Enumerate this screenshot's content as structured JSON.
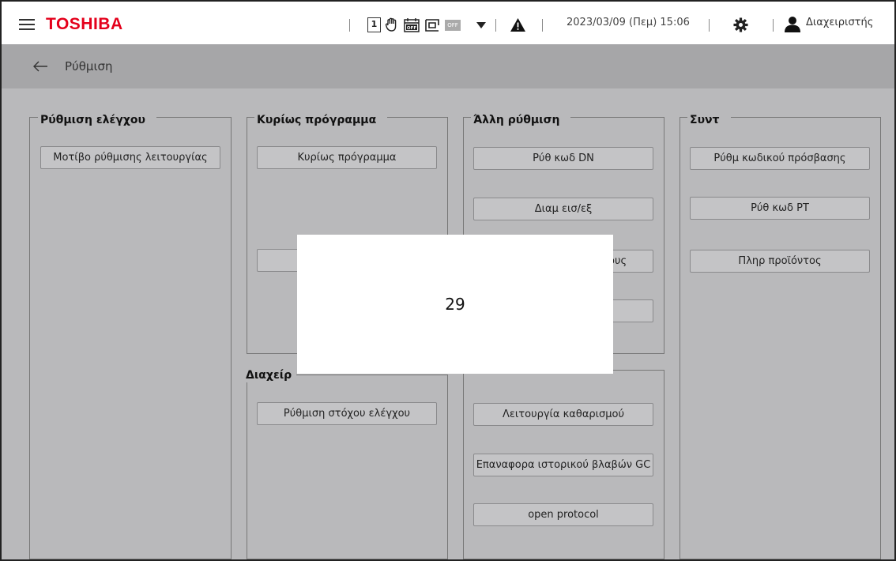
{
  "header": {
    "brand": "TOSHIBA",
    "mode_number": "1",
    "off_badge": "OFF",
    "datetime": "2023/03/09 (Πεμ) 15:06",
    "user": "Διαχειριστής"
  },
  "page": {
    "title": "Ρύθμιση"
  },
  "panels": {
    "control": {
      "title": "Ρύθμιση ελέγχου",
      "buttons": [
        "Μοτίβο ρύθμισης λειτουργίας"
      ]
    },
    "main_program": {
      "title": "Κυρίως πρόγραμμα",
      "buttons": [
        "Κυρίως πρόγραμμα"
      ]
    },
    "management": {
      "title_visible": "Διαχείρ",
      "buttons": [
        "Ρύθμιση στόχου ελέγχου"
      ]
    },
    "other": {
      "title": "Άλλη ρύθμιση",
      "buttons": [
        "Ρύθ κωδ DN",
        "Διαμ εισ/εξ",
        "ους"
      ]
    },
    "maintenance": {
      "buttons": [
        "Λειτουργία καθαρισμού",
        "Επαναφορα ιστορικού βλαβών GC",
        "open protocol"
      ]
    },
    "maint": {
      "title": "Συντ",
      "buttons": [
        "Ρύθμ κωδικού πρόσβασης",
        "Ρύθ κωδ PT",
        "Πληρ προϊόντος"
      ]
    }
  },
  "overlay": {
    "value": "29"
  },
  "colors": {
    "brand": "#e4001b",
    "background": "#b9b9bb",
    "titlebar": "#a6a6a8",
    "button": "#c4c4c6"
  }
}
